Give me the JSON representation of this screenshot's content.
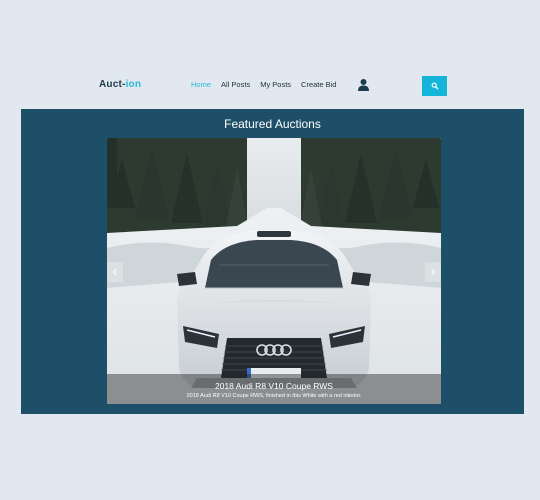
{
  "brand": {
    "part1": "Auct-",
    "part2": "ion",
    "accent_color": "#2ab7d5"
  },
  "nav": {
    "items": [
      {
        "label": "Home",
        "active": true
      },
      {
        "label": "All Posts",
        "active": false
      },
      {
        "label": "My Posts",
        "active": false
      },
      {
        "label": "Create Bid",
        "active": false
      }
    ],
    "user_icon": "user-icon",
    "search_icon": "search-icon"
  },
  "featured": {
    "title": "Featured Auctions",
    "background": "#1d5068",
    "slide": {
      "title": "2018 Audi R8 V10 Coupe RWS",
      "description": "2018 Audi R8 V10 Coupe RWS, finished in Ibis White with a red interior."
    },
    "prev_icon": "chevron-left-icon",
    "next_icon": "chevron-right-icon"
  }
}
